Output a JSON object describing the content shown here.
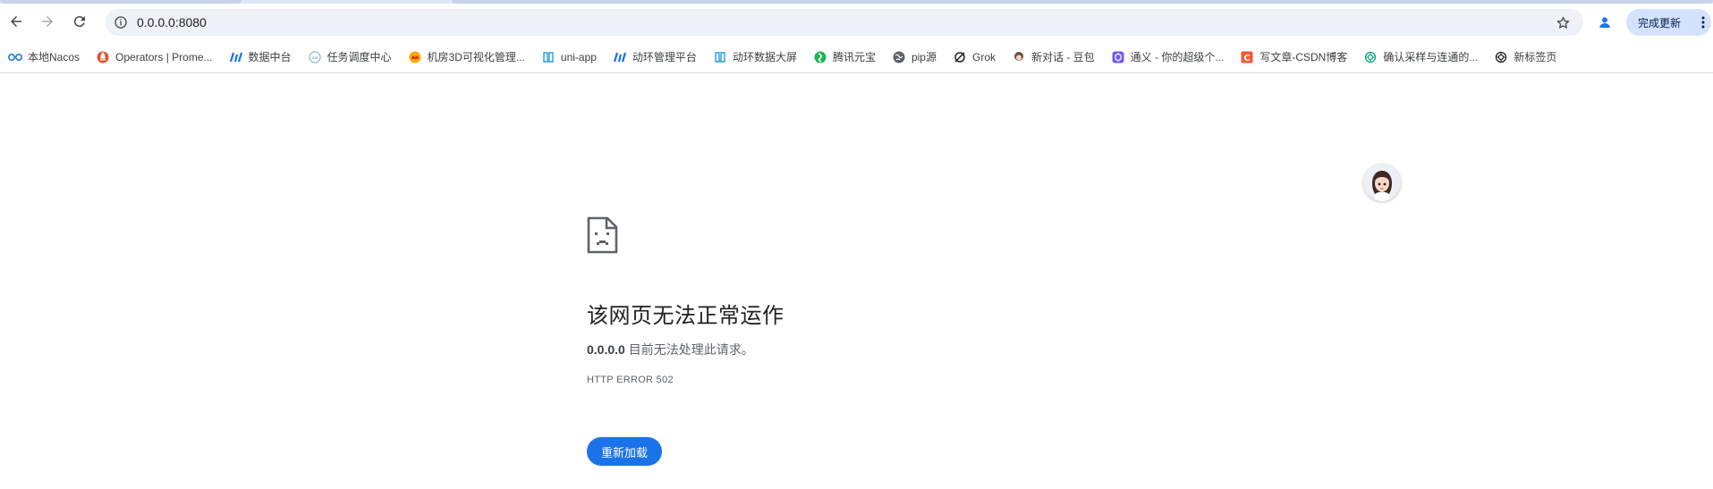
{
  "browser": {
    "url": "0.0.0.0:8080",
    "update_label": "完成更新"
  },
  "bookmarks": [
    {
      "label": "本地Nacos",
      "icon": "nacos-icon",
      "color": "#1c7ed6"
    },
    {
      "label": "Operators | Prome...",
      "icon": "prometheus-icon",
      "color": "#e6522c"
    },
    {
      "label": "数据中台",
      "icon": "bars-logo-icon",
      "color": "#1a73e8"
    },
    {
      "label": "任务调度中心",
      "icon": "globe-outline-icon",
      "color": "#8ab4c8"
    },
    {
      "label": "机房3D可视化管理...",
      "icon": "crown-icon",
      "color": "#d93025"
    },
    {
      "label": "uni-app",
      "icon": "book-icon",
      "color": "#2b9cd8"
    },
    {
      "label": "动环管理平台",
      "icon": "bars-logo-icon",
      "color": "#1a73e8"
    },
    {
      "label": "动环数据大屏",
      "icon": "book-icon",
      "color": "#2b9cd8"
    },
    {
      "label": "腾讯元宝",
      "icon": "yuanbao-icon",
      "color": "#1fb356"
    },
    {
      "label": "pip源",
      "icon": "globe-icon",
      "color": "#5f6368"
    },
    {
      "label": "Grok",
      "icon": "grok-icon",
      "color": "#202124"
    },
    {
      "label": "新对话 - 豆包",
      "icon": "doubao-icon",
      "color": "#6b4e3d"
    },
    {
      "label": "通义 - 你的超级个...",
      "icon": "tongyi-icon",
      "color": "#6f5cf1"
    },
    {
      "label": "写文章-CSDN博客",
      "icon": "csdn-icon",
      "color": "#fc5531"
    },
    {
      "label": "确认采样与连通的...",
      "icon": "openai-icon",
      "color": "#10a37f"
    },
    {
      "label": "新标签页",
      "icon": "openai-icon",
      "color": "#202124"
    }
  ],
  "error_page": {
    "title": "该网页无法正常运作",
    "host": "0.0.0.0",
    "message": " 目前无法处理此请求。",
    "code": "HTTP ERROR 502",
    "reload_label": "重新加载"
  },
  "colors": {
    "accent": "#1a73e8",
    "omnibox_bg": "#eef1f8",
    "update_bg": "#d3e3fd"
  }
}
